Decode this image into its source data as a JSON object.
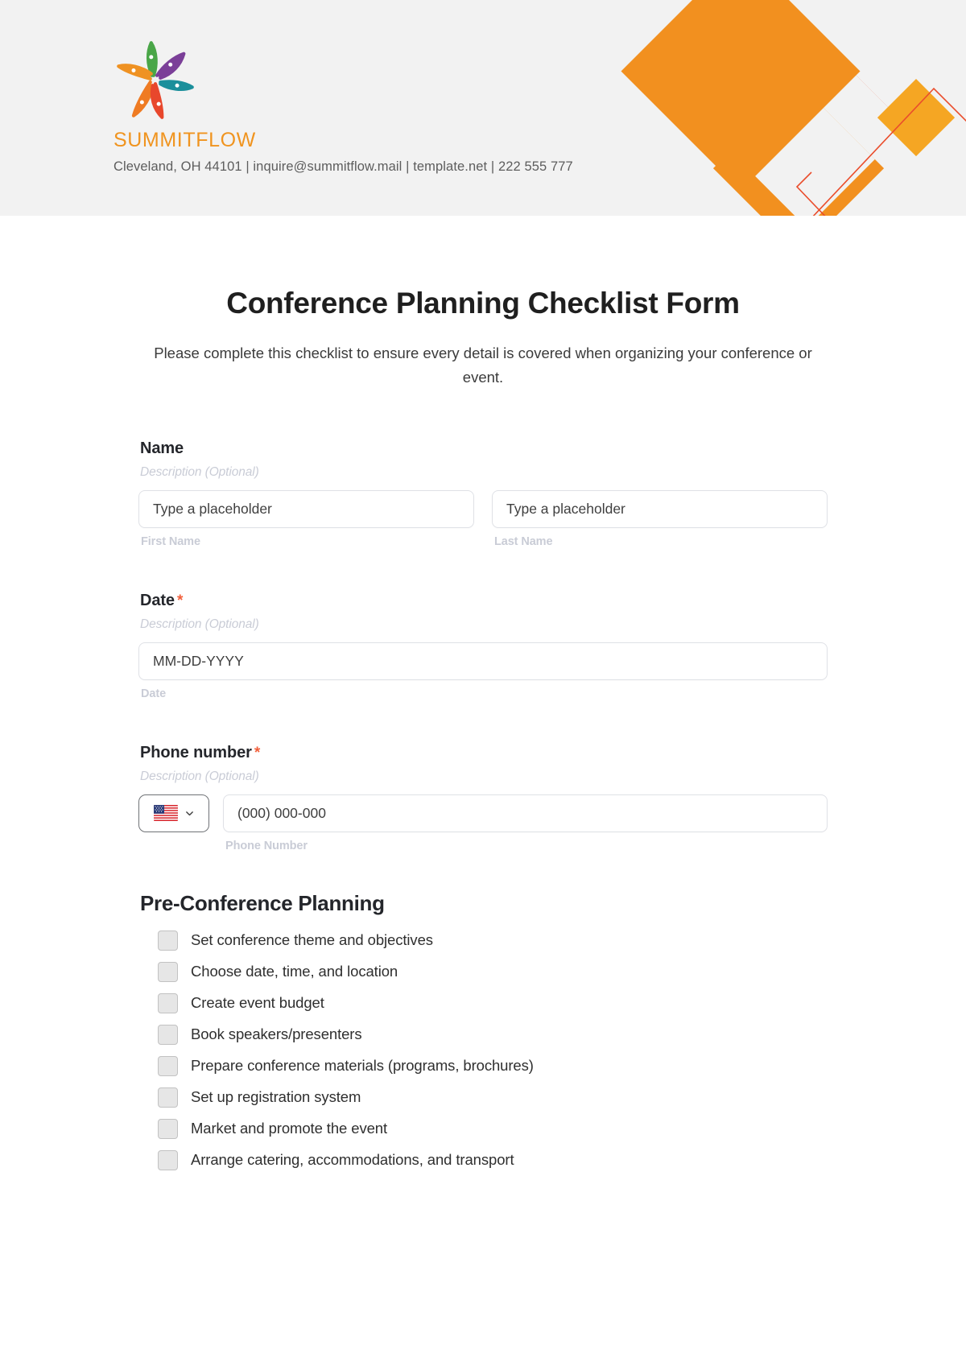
{
  "header": {
    "brand_name": "SUMMITFLOW",
    "contact_line": "Cleveland, OH 44101 | inquire@summitflow.mail | template.net | 222 555 777",
    "colors": {
      "background": "#f2f2f2",
      "brand_orange": "#f0941f",
      "deco_red": "#ea4d2c",
      "deco_orange": "#f2901f",
      "deco_yellow": "#f5a623"
    }
  },
  "form": {
    "title": "Conference Planning Checklist Form",
    "subtitle": "Please complete this checklist to ensure every detail is covered when organizing your conference or event.",
    "required_mark": "*",
    "fields": [
      {
        "label": "Name",
        "required": false,
        "description": "Description (Optional)",
        "inputs": [
          {
            "placeholder": "Type a placeholder",
            "sub_label": "First Name"
          },
          {
            "placeholder": "Type a placeholder",
            "sub_label": "Last Name"
          }
        ]
      },
      {
        "label": "Date",
        "required": true,
        "description": "Description (Optional)",
        "inputs": [
          {
            "placeholder": "MM-DD-YYYY",
            "sub_label": "Date"
          }
        ]
      },
      {
        "label": "Phone number",
        "required": true,
        "description": "Description (Optional)",
        "country_code_selected": "US",
        "inputs": [
          {
            "placeholder": "(000) 000-000",
            "sub_label": "Phone Number"
          }
        ]
      }
    ],
    "checklist_section": {
      "title": "Pre-Conference Planning",
      "items": [
        "Set conference theme and objectives",
        "Choose date, time, and location",
        "Create event budget",
        "Book speakers/presenters",
        "Prepare conference materials (programs, brochures)",
        "Set up registration system",
        "Market and promote the event",
        "Arrange catering, accommodations, and transport"
      ]
    }
  }
}
